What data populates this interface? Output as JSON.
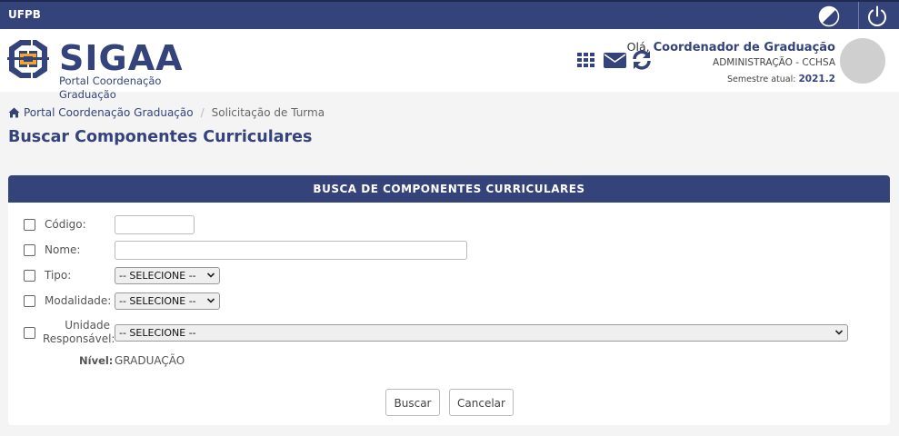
{
  "topbar": {
    "brand": "UFPB",
    "contrast_icon": "contrast-icon",
    "power_icon": "power-icon"
  },
  "header": {
    "logo_title": "SIGAA",
    "logo_subtitle": "Portal Coordenação Graduação",
    "icons": [
      "grid-menu-icon",
      "envelope-icon",
      "refresh-icon"
    ],
    "greeting_prefix": "Olá,",
    "user_name": "Coordenador de Graduação",
    "department": "ADMINISTRAÇÃO - CCHSA",
    "semester_label": "Semestre atual:",
    "semester_value": "2021.2"
  },
  "breadcrumb": {
    "home_icon": "home-icon",
    "home": "Portal Coordenação Graduação",
    "current": "Solicitação de Turma"
  },
  "page_title": "Buscar Componentes Curriculares",
  "form": {
    "panel_title": "BUSCA DE COMPONENTES CURRICULARES",
    "fields": {
      "codigo": {
        "label": "Código:",
        "value": ""
      },
      "nome": {
        "label": "Nome:",
        "value": ""
      },
      "tipo": {
        "label": "Tipo:",
        "selected": "-- SELECIONE --"
      },
      "modalidade": {
        "label": "Modalidade:",
        "selected": "-- SELECIONE --"
      },
      "unidade": {
        "label_line1": "Unidade",
        "label_line2": "Responsável:",
        "selected": "-- SELECIONE --"
      },
      "nivel": {
        "label": "Nível:",
        "value": "GRADUAÇÃO"
      }
    },
    "buttons": {
      "search": "Buscar",
      "cancel": "Cancelar"
    }
  },
  "colors": {
    "primary": "#34447b",
    "accent": "#f5a623",
    "background": "#f4f4f4"
  }
}
